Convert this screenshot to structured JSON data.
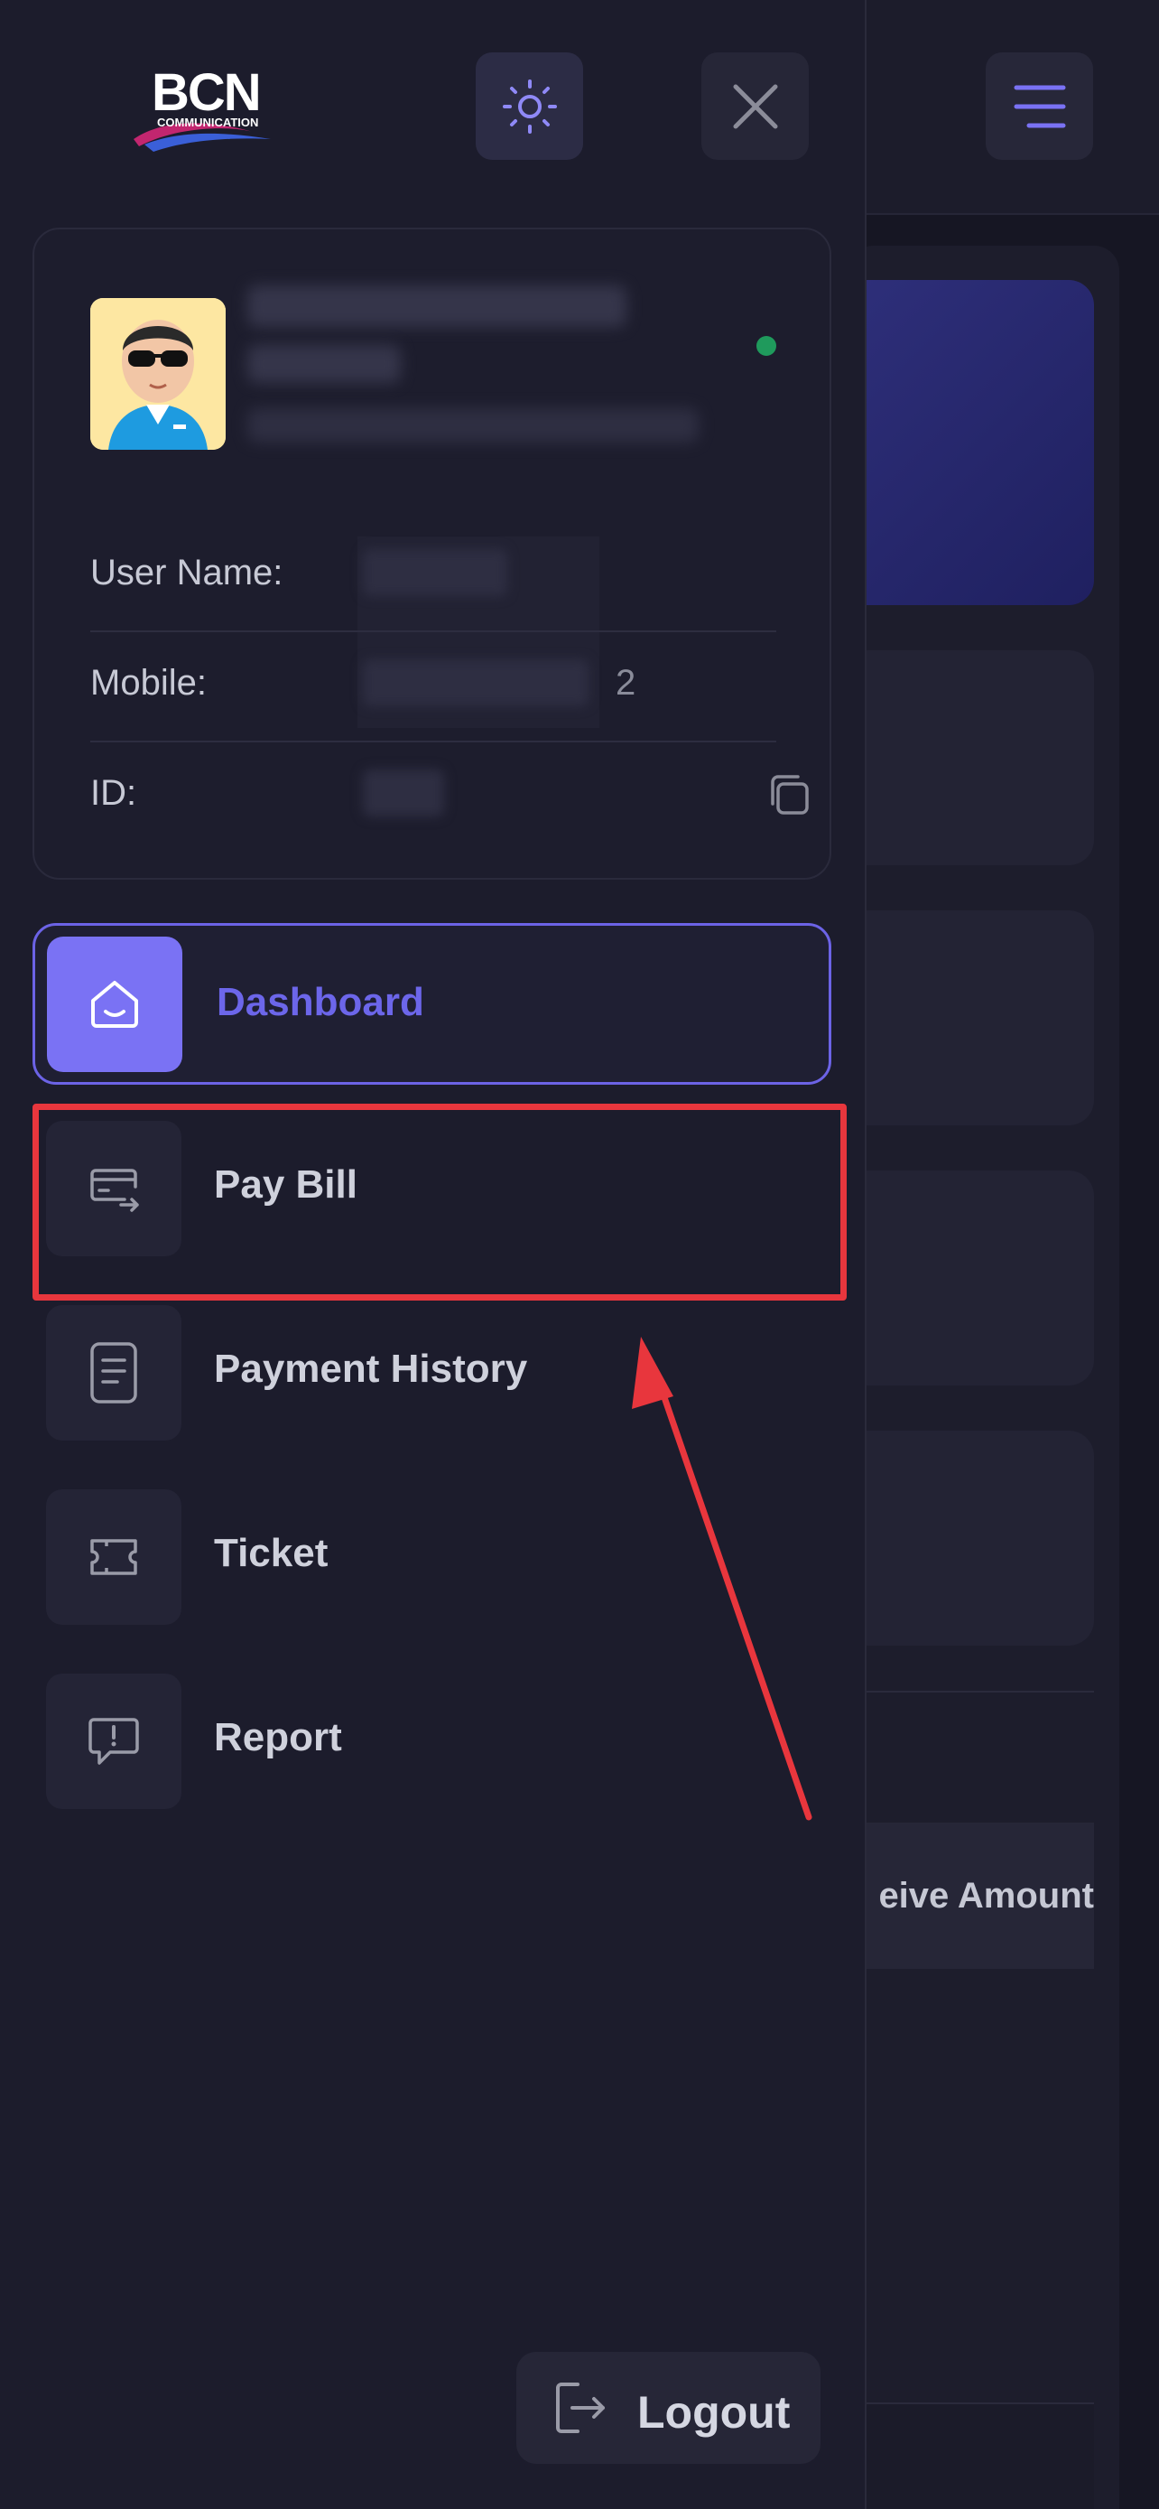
{
  "background": {
    "table_header_partial": "eive Amount"
  },
  "header": {
    "logo_text": "BCN",
    "logo_subtext": "COMMUNICATION"
  },
  "profile": {
    "status": "online",
    "fields": [
      {
        "label": "User Name:"
      },
      {
        "label": "Mobile:",
        "visible_suffix": "2"
      },
      {
        "label": "ID:"
      }
    ]
  },
  "nav": {
    "items": [
      {
        "label": "Dashboard",
        "icon": "home-icon",
        "active": true
      },
      {
        "label": "Pay Bill",
        "icon": "card-transfer-icon",
        "active": false
      },
      {
        "label": "Payment History",
        "icon": "document-icon",
        "active": false
      },
      {
        "label": "Ticket",
        "icon": "ticket-icon",
        "active": false
      },
      {
        "label": "Report",
        "icon": "message-alert-icon",
        "active": false
      }
    ]
  },
  "logout_label": "Logout",
  "colors": {
    "accent": "#6c66ea",
    "highlight": "#e8363d",
    "online": "#1f9a5c"
  }
}
